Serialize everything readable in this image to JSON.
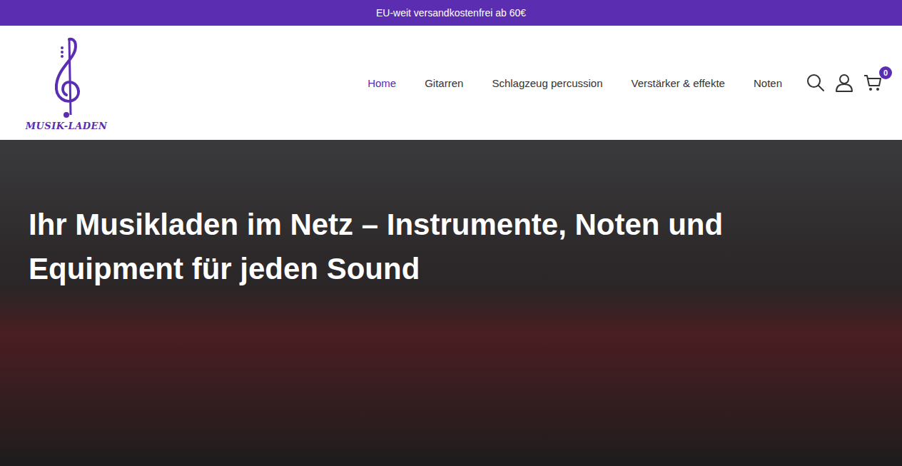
{
  "announcement": "EU-weit versandkostenfrei ab 60€",
  "logo": {
    "text": "MUSIK-LADEN"
  },
  "nav": [
    {
      "label": "Home",
      "selected": true
    },
    {
      "label": "Gitarren",
      "selected": false
    },
    {
      "label": "Schlagzeug percussion",
      "selected": false
    },
    {
      "label": "Verstärker & effekte",
      "selected": false
    },
    {
      "label": "Noten",
      "selected": false
    }
  ],
  "cart": {
    "count": "0"
  },
  "hero": {
    "title": "Ihr Musikladen im Netz – Instrumente, Noten und Equipment für jeden Sound"
  }
}
